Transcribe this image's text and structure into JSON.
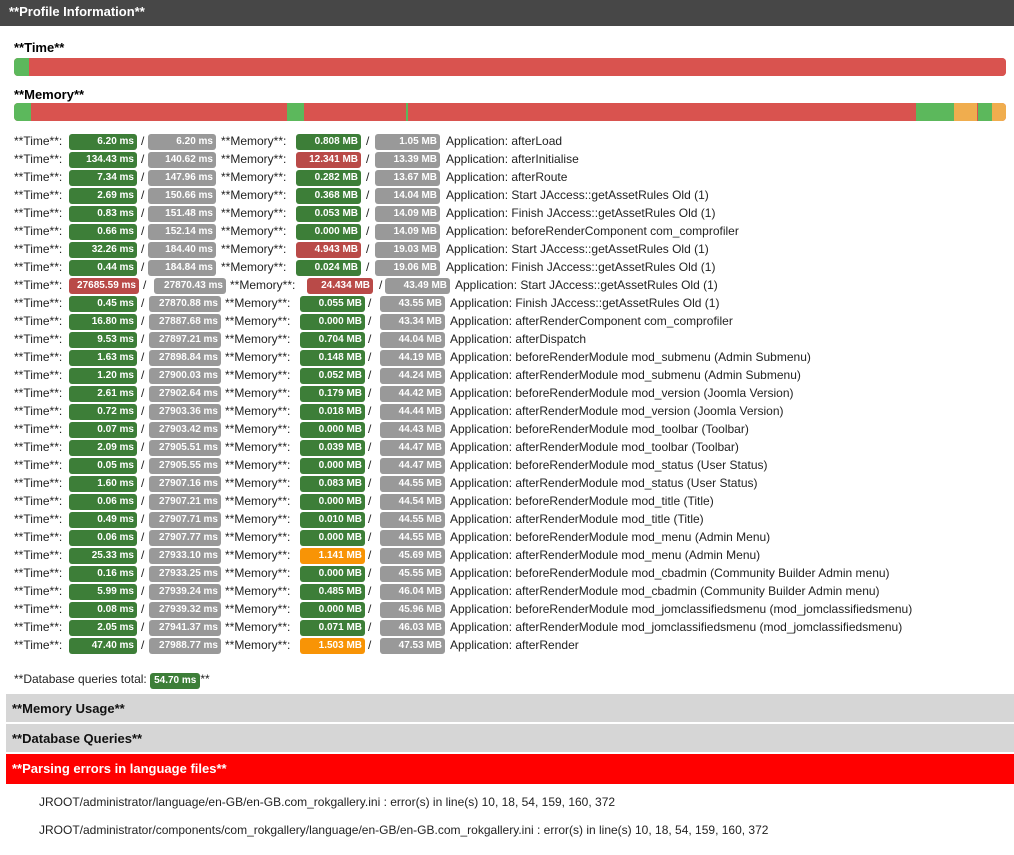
{
  "header": {
    "title": "**Profile Information**"
  },
  "time_section": {
    "title": "**Time**"
  },
  "memory_section": {
    "title": "**Memory**"
  },
  "labels": {
    "time": "**Time**:",
    "memory": "**Memory**:",
    "slash": "/"
  },
  "colors": {
    "green_badge": "#3d7e38",
    "grey_badge": "#999999",
    "red_badge": "#b94a48",
    "orange_badge": "#f89406",
    "bar_green": "#5cb85c",
    "bar_red": "#d9534f",
    "bar_orange": "#f0ad4e"
  },
  "rows": [
    {
      "t": "6.20 ms",
      "tt": "6.20 ms",
      "m": "0.808 MB",
      "mt": "1.05 MB",
      "msg": "Application: afterLoad",
      "tc": "g",
      "mc": "g"
    },
    {
      "t": "134.43 ms",
      "tt": "140.62 ms",
      "m": "12.341 MB",
      "mt": "13.39 MB",
      "msg": "Application: afterInitialise",
      "tc": "g",
      "mc": "r"
    },
    {
      "t": "7.34 ms",
      "tt": "147.96 ms",
      "m": "0.282 MB",
      "mt": "13.67 MB",
      "msg": "Application: afterRoute",
      "tc": "g",
      "mc": "g"
    },
    {
      "t": "2.69 ms",
      "tt": "150.66 ms",
      "m": "0.368 MB",
      "mt": "14.04 MB",
      "msg": "Application: Start JAccess::getAssetRules Old (1)",
      "tc": "g",
      "mc": "g"
    },
    {
      "t": "0.83 ms",
      "tt": "151.48 ms",
      "m": "0.053 MB",
      "mt": "14.09 MB",
      "msg": "Application: Finish JAccess::getAssetRules Old (1)",
      "tc": "g",
      "mc": "g"
    },
    {
      "t": "0.66 ms",
      "tt": "152.14 ms",
      "m": "0.000 MB",
      "mt": "14.09 MB",
      "msg": "Application: beforeRenderComponent com_comprofiler",
      "tc": "g",
      "mc": "g"
    },
    {
      "t": "32.26 ms",
      "tt": "184.40 ms",
      "m": "4.943 MB",
      "mt": "19.03 MB",
      "msg": "Application: Start JAccess::getAssetRules Old (1)",
      "tc": "g",
      "mc": "r"
    },
    {
      "t": "0.44 ms",
      "tt": "184.84 ms",
      "m": "0.024 MB",
      "mt": "19.06 MB",
      "msg": "Application: Finish JAccess::getAssetRules Old (1)",
      "tc": "g",
      "mc": "g"
    },
    {
      "t": "27685.59 ms",
      "tt": "27870.43 ms",
      "m": "24.434 MB",
      "mt": "43.49 MB",
      "msg": "Application: Start JAccess::getAssetRules Old (1)",
      "tc": "r",
      "mc": "r"
    },
    {
      "t": "0.45 ms",
      "tt": "27870.88 ms",
      "m": "0.055 MB",
      "mt": "43.55 MB",
      "msg": "Application: Finish JAccess::getAssetRules Old (1)",
      "tc": "g",
      "mc": "g"
    },
    {
      "t": "16.80 ms",
      "tt": "27887.68 ms",
      "m": "0.000 MB",
      "mt": "43.34 MB",
      "msg": "Application: afterRenderComponent com_comprofiler",
      "tc": "g",
      "mc": "g"
    },
    {
      "t": "9.53 ms",
      "tt": "27897.21 ms",
      "m": "0.704 MB",
      "mt": "44.04 MB",
      "msg": "Application: afterDispatch",
      "tc": "g",
      "mc": "g"
    },
    {
      "t": "1.63 ms",
      "tt": "27898.84 ms",
      "m": "0.148 MB",
      "mt": "44.19 MB",
      "msg": "Application: beforeRenderModule mod_submenu (Admin Submenu)",
      "tc": "g",
      "mc": "g"
    },
    {
      "t": "1.20 ms",
      "tt": "27900.03 ms",
      "m": "0.052 MB",
      "mt": "44.24 MB",
      "msg": "Application: afterRenderModule mod_submenu (Admin Submenu)",
      "tc": "g",
      "mc": "g"
    },
    {
      "t": "2.61 ms",
      "tt": "27902.64 ms",
      "m": "0.179 MB",
      "mt": "44.42 MB",
      "msg": "Application: beforeRenderModule mod_version (Joomla Version)",
      "tc": "g",
      "mc": "g"
    },
    {
      "t": "0.72 ms",
      "tt": "27903.36 ms",
      "m": "0.018 MB",
      "mt": "44.44 MB",
      "msg": "Application: afterRenderModule mod_version (Joomla Version)",
      "tc": "g",
      "mc": "g"
    },
    {
      "t": "0.07 ms",
      "tt": "27903.42 ms",
      "m": "0.000 MB",
      "mt": "44.43 MB",
      "msg": "Application: beforeRenderModule mod_toolbar (Toolbar)",
      "tc": "g",
      "mc": "g"
    },
    {
      "t": "2.09 ms",
      "tt": "27905.51 ms",
      "m": "0.039 MB",
      "mt": "44.47 MB",
      "msg": "Application: afterRenderModule mod_toolbar (Toolbar)",
      "tc": "g",
      "mc": "g"
    },
    {
      "t": "0.05 ms",
      "tt": "27905.55 ms",
      "m": "0.000 MB",
      "mt": "44.47 MB",
      "msg": "Application: beforeRenderModule mod_status (User Status)",
      "tc": "g",
      "mc": "g"
    },
    {
      "t": "1.60 ms",
      "tt": "27907.16 ms",
      "m": "0.083 MB",
      "mt": "44.55 MB",
      "msg": "Application: afterRenderModule mod_status (User Status)",
      "tc": "g",
      "mc": "g"
    },
    {
      "t": "0.06 ms",
      "tt": "27907.21 ms",
      "m": "0.000 MB",
      "mt": "44.54 MB",
      "msg": "Application: beforeRenderModule mod_title (Title)",
      "tc": "g",
      "mc": "g"
    },
    {
      "t": "0.49 ms",
      "tt": "27907.71 ms",
      "m": "0.010 MB",
      "mt": "44.55 MB",
      "msg": "Application: afterRenderModule mod_title (Title)",
      "tc": "g",
      "mc": "g"
    },
    {
      "t": "0.06 ms",
      "tt": "27907.77 ms",
      "m": "0.000 MB",
      "mt": "44.55 MB",
      "msg": "Application: beforeRenderModule mod_menu (Admin Menu)",
      "tc": "g",
      "mc": "g"
    },
    {
      "t": "25.33 ms",
      "tt": "27933.10 ms",
      "m": "1.141 MB",
      "mt": "45.69 MB",
      "msg": "Application: afterRenderModule mod_menu (Admin Menu)",
      "tc": "g",
      "mc": "o"
    },
    {
      "t": "0.16 ms",
      "tt": "27933.25 ms",
      "m": "0.000 MB",
      "mt": "45.55 MB",
      "msg": "Application: beforeRenderModule mod_cbadmin (Community Builder Admin menu)",
      "tc": "g",
      "mc": "g"
    },
    {
      "t": "5.99 ms",
      "tt": "27939.24 ms",
      "m": "0.485 MB",
      "mt": "46.04 MB",
      "msg": "Application: afterRenderModule mod_cbadmin (Community Builder Admin menu)",
      "tc": "g",
      "mc": "g"
    },
    {
      "t": "0.08 ms",
      "tt": "27939.32 ms",
      "m": "0.000 MB",
      "mt": "45.96 MB",
      "msg": "Application: beforeRenderModule mod_jomclassifiedsmenu (mod_jomclassifiedsmenu)",
      "tc": "g",
      "mc": "g"
    },
    {
      "t": "2.05 ms",
      "tt": "27941.37 ms",
      "m": "0.071 MB",
      "mt": "46.03 MB",
      "msg": "Application: afterRenderModule mod_jomclassifiedsmenu (mod_jomclassifiedsmenu)",
      "tc": "g",
      "mc": "g"
    },
    {
      "t": "47.40 ms",
      "tt": "27988.77 ms",
      "m": "1.503 MB",
      "mt": "47.53 MB",
      "msg": "Application: afterRender",
      "tc": "g",
      "mc": "o"
    }
  ],
  "db": {
    "prefix": "**Database queries total:",
    "value": "54.70 ms",
    "suffix": "**"
  },
  "panels": {
    "memory_usage": "**Memory Usage**",
    "database_queries": "**Database Queries**",
    "parsing_errors": "**Parsing errors in language files**"
  },
  "errors": [
    "JROOT/administrator/language/en-GB/en-GB.com_rokgallery.ini : error(s) in line(s) 10, 18, 54, 159, 160, 372",
    "JROOT/administrator/components/com_rokgallery/language/en-GB/en-GB.com_rokgallery.ini : error(s) in line(s) 10, 18, 54, 159, 160, 372"
  ]
}
